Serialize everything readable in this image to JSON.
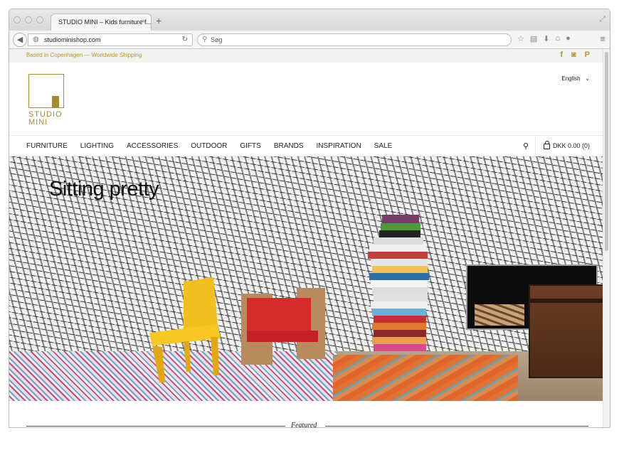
{
  "browser": {
    "tab_title": "STUDIO MINI – Kids furniture f...",
    "tab_close": "×",
    "new_tab": "+",
    "url": "studiominishop.com",
    "search_placeholder": "Søg",
    "icons": [
      "star-icon",
      "clipboard-icon",
      "download-icon",
      "home-icon",
      "chat-icon",
      "menu-icon"
    ]
  },
  "site": {
    "topbar_text": "Based in Copenhagen — Worldwide Shipping",
    "social": [
      "f",
      "◙",
      "P"
    ],
    "logo_line1": "STUDIO",
    "logo_line2": "MINI",
    "language": "English",
    "nav": [
      "FURNITURE",
      "LIGHTING",
      "ACCESSORIES",
      "OUTDOOR",
      "GIFTS",
      "BRANDS",
      "INSPIRATION",
      "SALE"
    ],
    "cart": "DKK 0.00 (0)",
    "hero_title": "Sitting pretty",
    "featured_label": "Featured",
    "colors": {
      "gold": "#b8972b",
      "text": "#222222"
    }
  }
}
